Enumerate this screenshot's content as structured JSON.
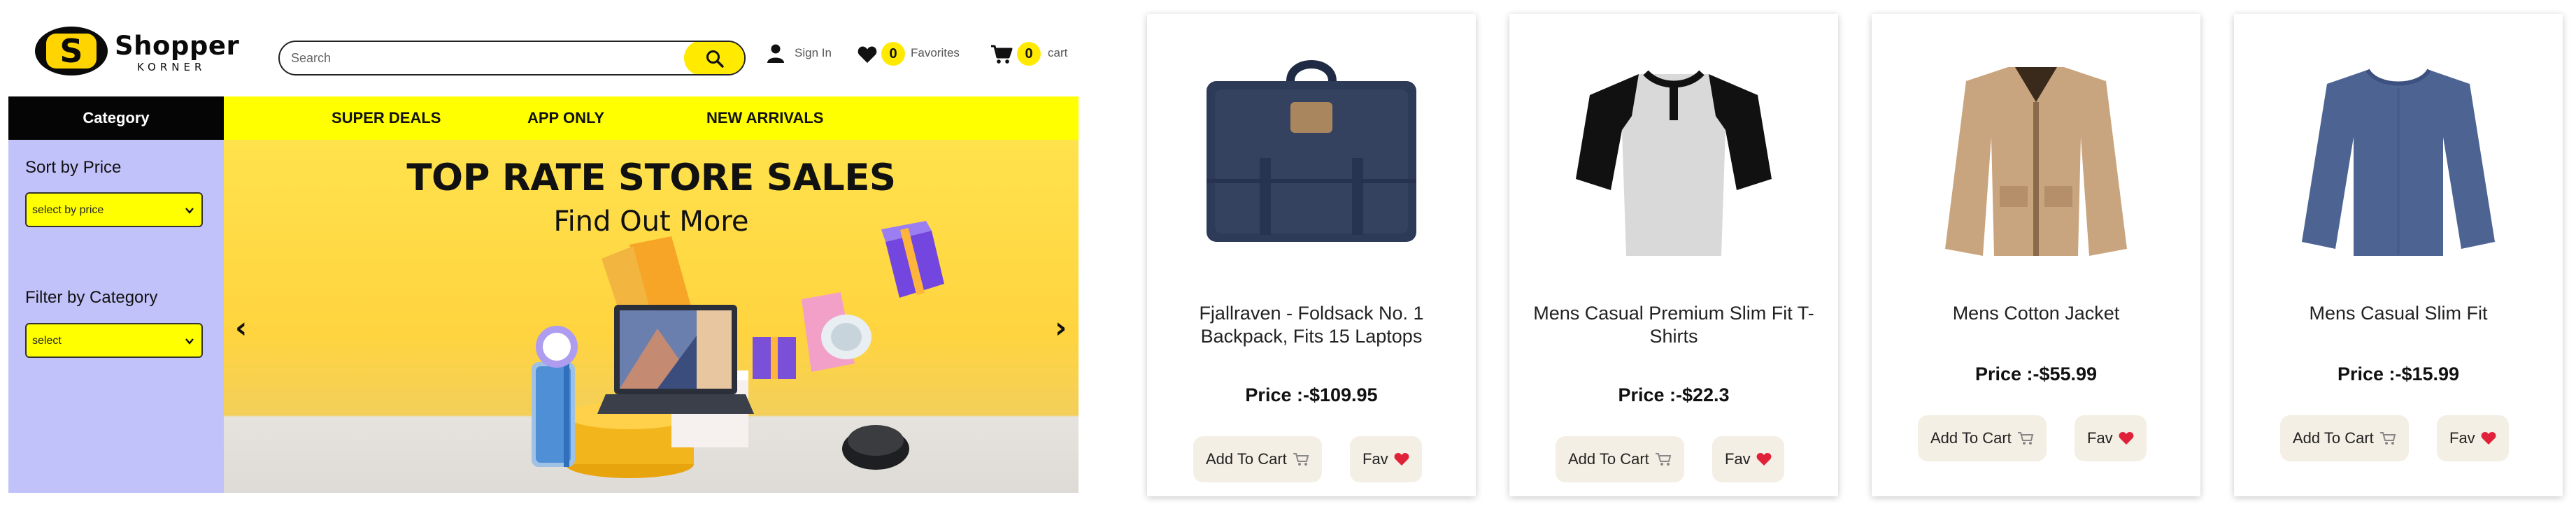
{
  "header": {
    "logo": {
      "name": "Shopper",
      "sub": "KORNER",
      "letter": "S"
    },
    "search": {
      "placeholder": "Search",
      "value": ""
    },
    "signin_label": "Sign In",
    "favorites": {
      "count": "0",
      "label": "Favorites"
    },
    "cart": {
      "count": "0",
      "label": "cart"
    }
  },
  "nav": {
    "category_label": "Category",
    "links": [
      "SUPER DEALS",
      "APP ONLY",
      "NEW ARRIVALS"
    ]
  },
  "sidebar": {
    "sort_label": "Sort by Price",
    "sort_select": "select by price",
    "filter_label": "Filter by Category",
    "filter_select": "select"
  },
  "banner": {
    "title": "TOP RATE STORE SALES",
    "subtitle": "Find Out More",
    "prev_arrow": "‹",
    "next_arrow": "›"
  },
  "products": [
    {
      "title": "Fjallraven - Foldsack No. 1 Backpack, Fits 15 Laptops",
      "price": "Price :-$109.95",
      "add_label": "Add To Cart",
      "fav_label": "Fav",
      "image": "backpack"
    },
    {
      "title": "Mens Casual Premium Slim Fit T-Shirts",
      "price": "Price :-$22.3",
      "add_label": "Add To Cart",
      "fav_label": "Fav",
      "image": "raglan-tshirt"
    },
    {
      "title": "Mens Cotton Jacket",
      "price": "Price :-$55.99",
      "add_label": "Add To Cart",
      "fav_label": "Fav",
      "image": "jacket"
    },
    {
      "title": "Mens Casual Slim Fit",
      "price": "Price :-$15.99",
      "add_label": "Add To Cart",
      "fav_label": "Fav",
      "image": "longsleeve-shirt"
    }
  ],
  "icons": {
    "search": "search-icon",
    "user": "user-icon",
    "heart": "heart-icon",
    "cart": "cart-icon",
    "chevron": "chevron-down-icon"
  },
  "colors": {
    "accent_yellow": "#ffff00",
    "button_yellow": "#ffea00",
    "sidebar_lavender": "#c2c2fb",
    "category_black": "#050505",
    "button_beige": "#f4efe4",
    "heart_red": "#e0213a"
  }
}
